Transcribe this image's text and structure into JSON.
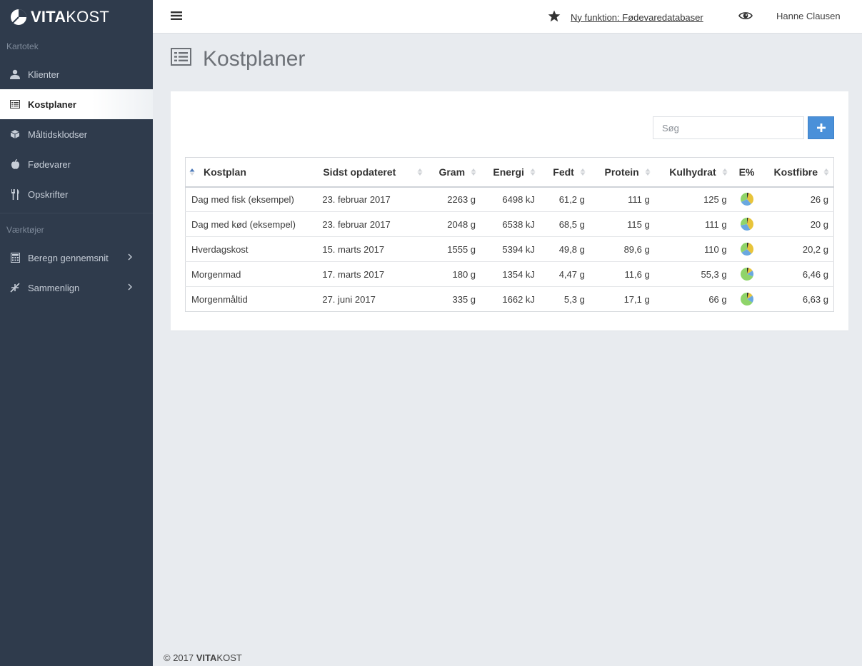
{
  "app": {
    "brand_bold": "VITA",
    "brand_light": "KOST"
  },
  "sidebar": {
    "section_kartotek": "Kartotek",
    "section_vaerktojer": "Værktøjer",
    "items": [
      {
        "label": "Klienter",
        "icon": "user-icon"
      },
      {
        "label": "Kostplaner",
        "icon": "list-icon",
        "active": true
      },
      {
        "label": "Måltidsklodser",
        "icon": "cube-icon"
      },
      {
        "label": "Fødevarer",
        "icon": "apple-icon"
      },
      {
        "label": "Opskrifter",
        "icon": "cutlery-icon"
      },
      {
        "label": "Beregn gennemsnit",
        "icon": "calculator-icon"
      },
      {
        "label": "Sammenlign",
        "icon": "compress-icon"
      }
    ]
  },
  "topbar": {
    "feature_link": "Ny funktion: Fødevaredatabaser",
    "user_name": "Hanne Clausen"
  },
  "page": {
    "title": "Kostplaner"
  },
  "search": {
    "placeholder": "Søg"
  },
  "table": {
    "headers": [
      "Kostplan",
      "Sidst opdateret",
      "Gram",
      "Energi",
      "Fedt",
      "Protein",
      "Kulhydrat",
      "E%",
      "Kostfibre"
    ],
    "rows": [
      {
        "name": "Dag med fisk (eksempel)",
        "updated": "23. februar 2017",
        "gram": "2263 g",
        "energi": "6498 kJ",
        "fedt": "61,2 g",
        "protein": "111 g",
        "kulhydrat": "125 g",
        "kostfibre": "26 g",
        "e_pct": {
          "fedt": 0.35,
          "protein": 0.29,
          "kulhydrat": 0.32,
          "other": 0.04
        }
      },
      {
        "name": "Dag med kød (eksempel)",
        "updated": "23. februar 2017",
        "gram": "2048 g",
        "energi": "6538 kJ",
        "fedt": "68,5 g",
        "protein": "115 g",
        "kulhydrat": "111 g",
        "kostfibre": "20 g",
        "e_pct": {
          "fedt": 0.39,
          "protein": 0.3,
          "kulhydrat": 0.28,
          "other": 0.03
        }
      },
      {
        "name": "Hverdagskost",
        "updated": "15. marts 2017",
        "gram": "1555 g",
        "energi": "5394 kJ",
        "fedt": "49,8 g",
        "protein": "89,6 g",
        "kulhydrat": "110 g",
        "kostfibre": "20,2 g",
        "e_pct": {
          "fedt": 0.34,
          "protein": 0.28,
          "kulhydrat": 0.34,
          "other": 0.04
        }
      },
      {
        "name": "Morgenmad",
        "updated": "17. marts 2017",
        "gram": "180 g",
        "energi": "1354 kJ",
        "fedt": "4,47 g",
        "protein": "11,6 g",
        "kulhydrat": "55,3 g",
        "kostfibre": "6,46 g",
        "e_pct": {
          "fedt": 0.12,
          "protein": 0.15,
          "kulhydrat": 0.69,
          "other": 0.04
        }
      },
      {
        "name": "Morgenmåltid",
        "updated": "27. juni 2017",
        "gram": "335 g",
        "energi": "1662 kJ",
        "fedt": "5,3 g",
        "protein": "17,1 g",
        "kulhydrat": "66 g",
        "kostfibre": "6,63 g",
        "e_pct": {
          "fedt": 0.12,
          "protein": 0.18,
          "kulhydrat": 0.66,
          "other": 0.04
        }
      }
    ]
  },
  "colors": {
    "sidebar_bg": "#2f3b4c",
    "accent": "#4a90d9",
    "pie_fedt": "#e8c43a",
    "pie_protein": "#6aa8e0",
    "pie_kulhydrat": "#8fd46a",
    "pie_other": "#2a2a2a"
  },
  "footer": {
    "prefix": "© 2017",
    "brand_bold": "VITA",
    "brand_light": "KOST"
  }
}
